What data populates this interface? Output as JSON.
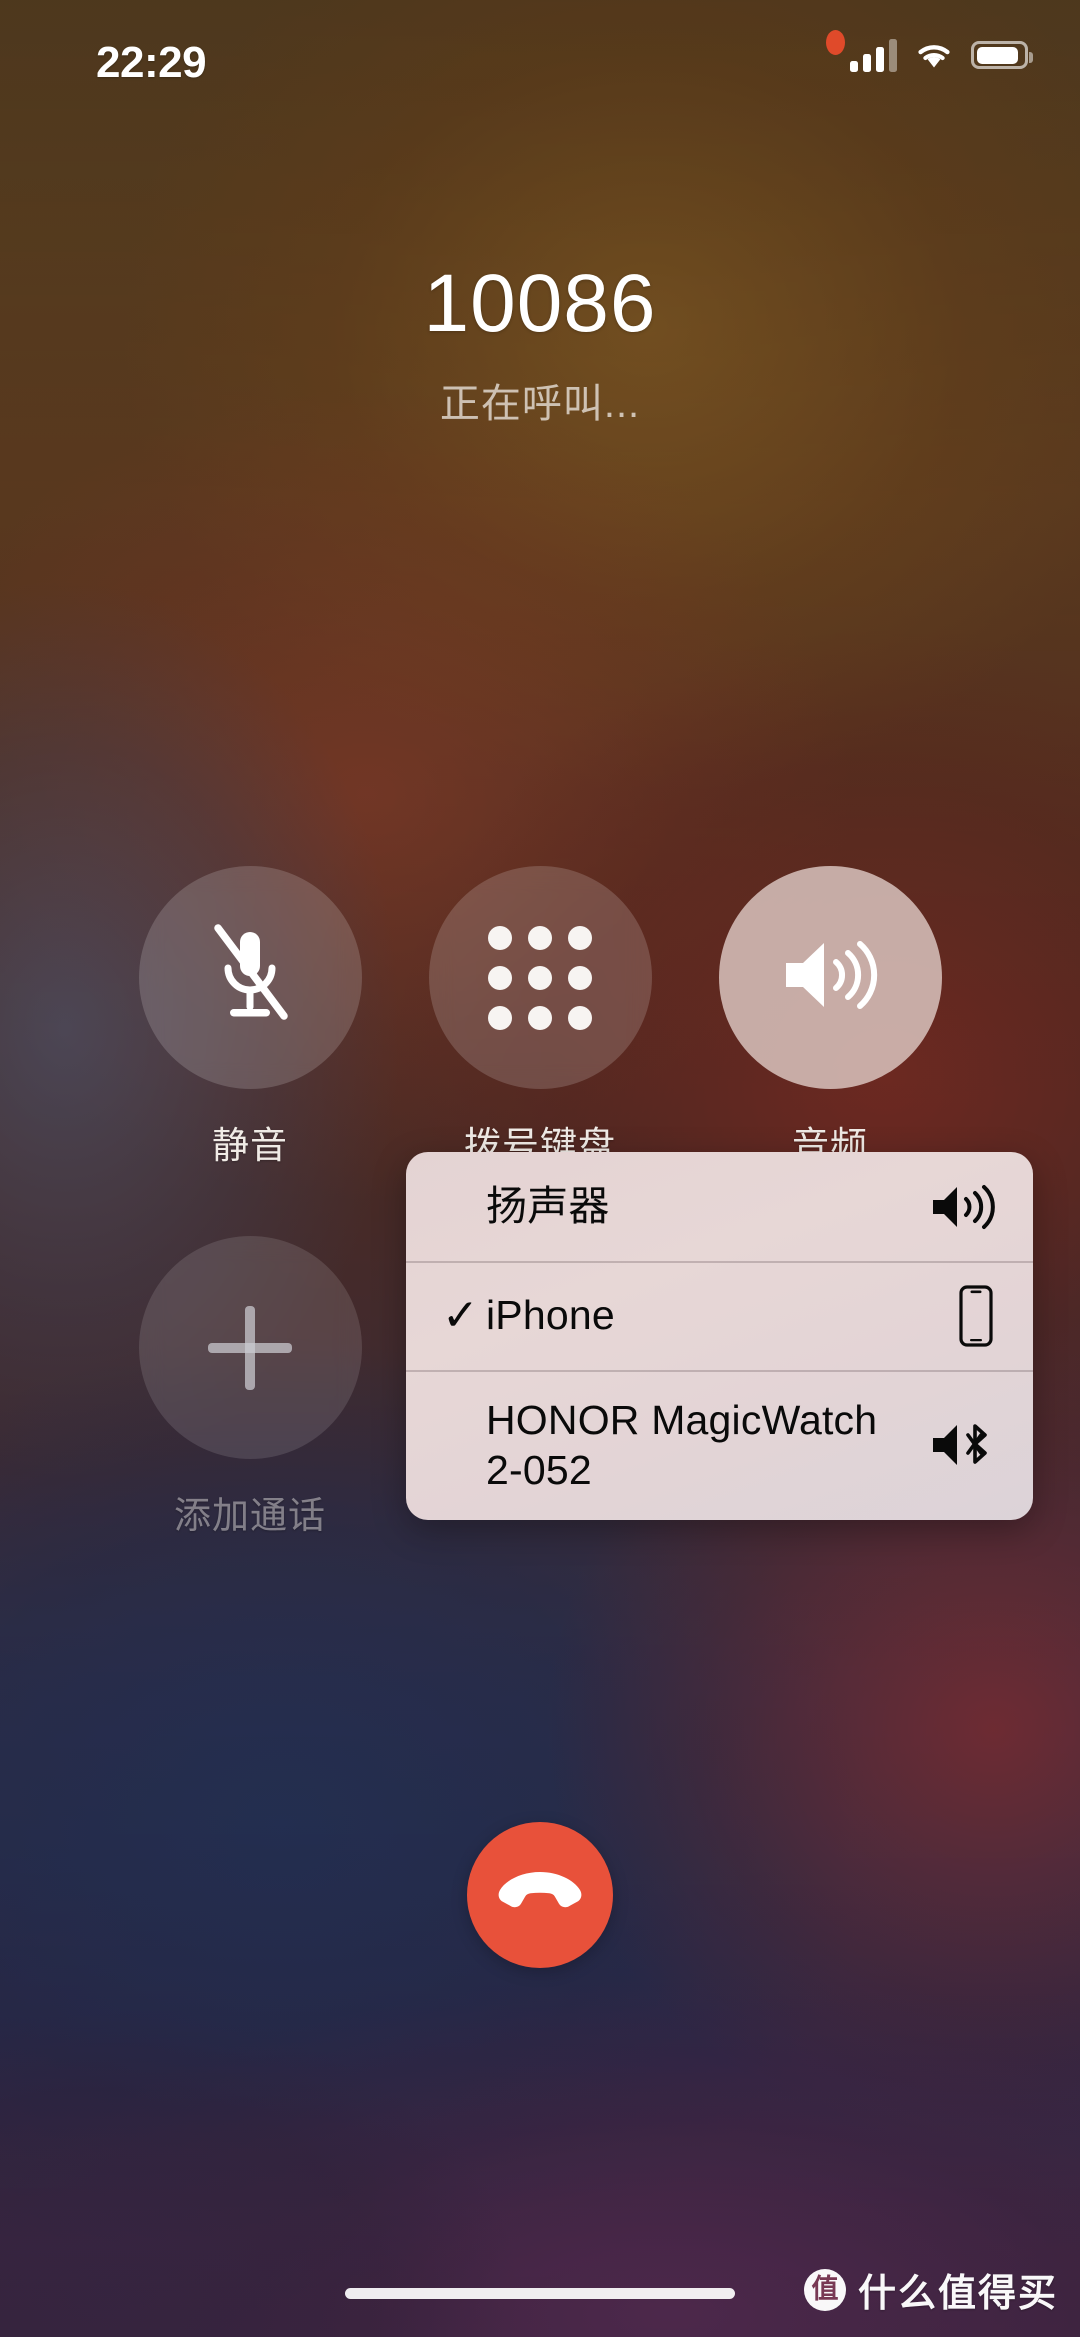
{
  "status_bar": {
    "time": "22:29",
    "recording_indicator": "recording-dot",
    "cellular_icon": "cellular-signal-icon",
    "cellular_bars_filled": 3,
    "cellular_bars_total": 4,
    "wifi_icon": "wifi-icon",
    "battery_icon": "battery-icon",
    "battery_level_percent": 82
  },
  "call": {
    "number": "10086",
    "status_text": "正在呼叫..."
  },
  "controls": [
    {
      "id": "mute",
      "label": "静音",
      "icon": "microphone-slash-icon",
      "state": "inactive"
    },
    {
      "id": "keypad",
      "label": "拨号键盘",
      "icon": "keypad-grid-icon",
      "state": "inactive"
    },
    {
      "id": "audio",
      "label": "音频",
      "icon": "speaker-waves-icon",
      "state": "active"
    },
    {
      "id": "add-call",
      "label": "添加通话",
      "icon": "plus-icon",
      "state": "disabled"
    }
  ],
  "audio_popup": {
    "items": [
      {
        "label": "扬声器",
        "icon": "speaker-waves-icon",
        "checked": false,
        "check_glyph": ""
      },
      {
        "label": "iPhone",
        "icon": "iphone-device-icon",
        "checked": true,
        "check_glyph": "✓"
      },
      {
        "label": "HONOR MagicWatch 2-052",
        "icon": "speaker-bluetooth-icon",
        "checked": false,
        "check_glyph": ""
      }
    ]
  },
  "end_call": {
    "icon": "phone-down-icon",
    "color": "#e8513a"
  },
  "home_indicator": "home-indicator-bar",
  "watermark": {
    "logo_glyph": "值",
    "text": "什么值得买"
  },
  "colors": {
    "end_call_red": "#e8513a",
    "recording_dot": "#e04a2a",
    "popup_background": "#e4d3d3",
    "active_button": "rgba(225,205,200,0.80)"
  }
}
